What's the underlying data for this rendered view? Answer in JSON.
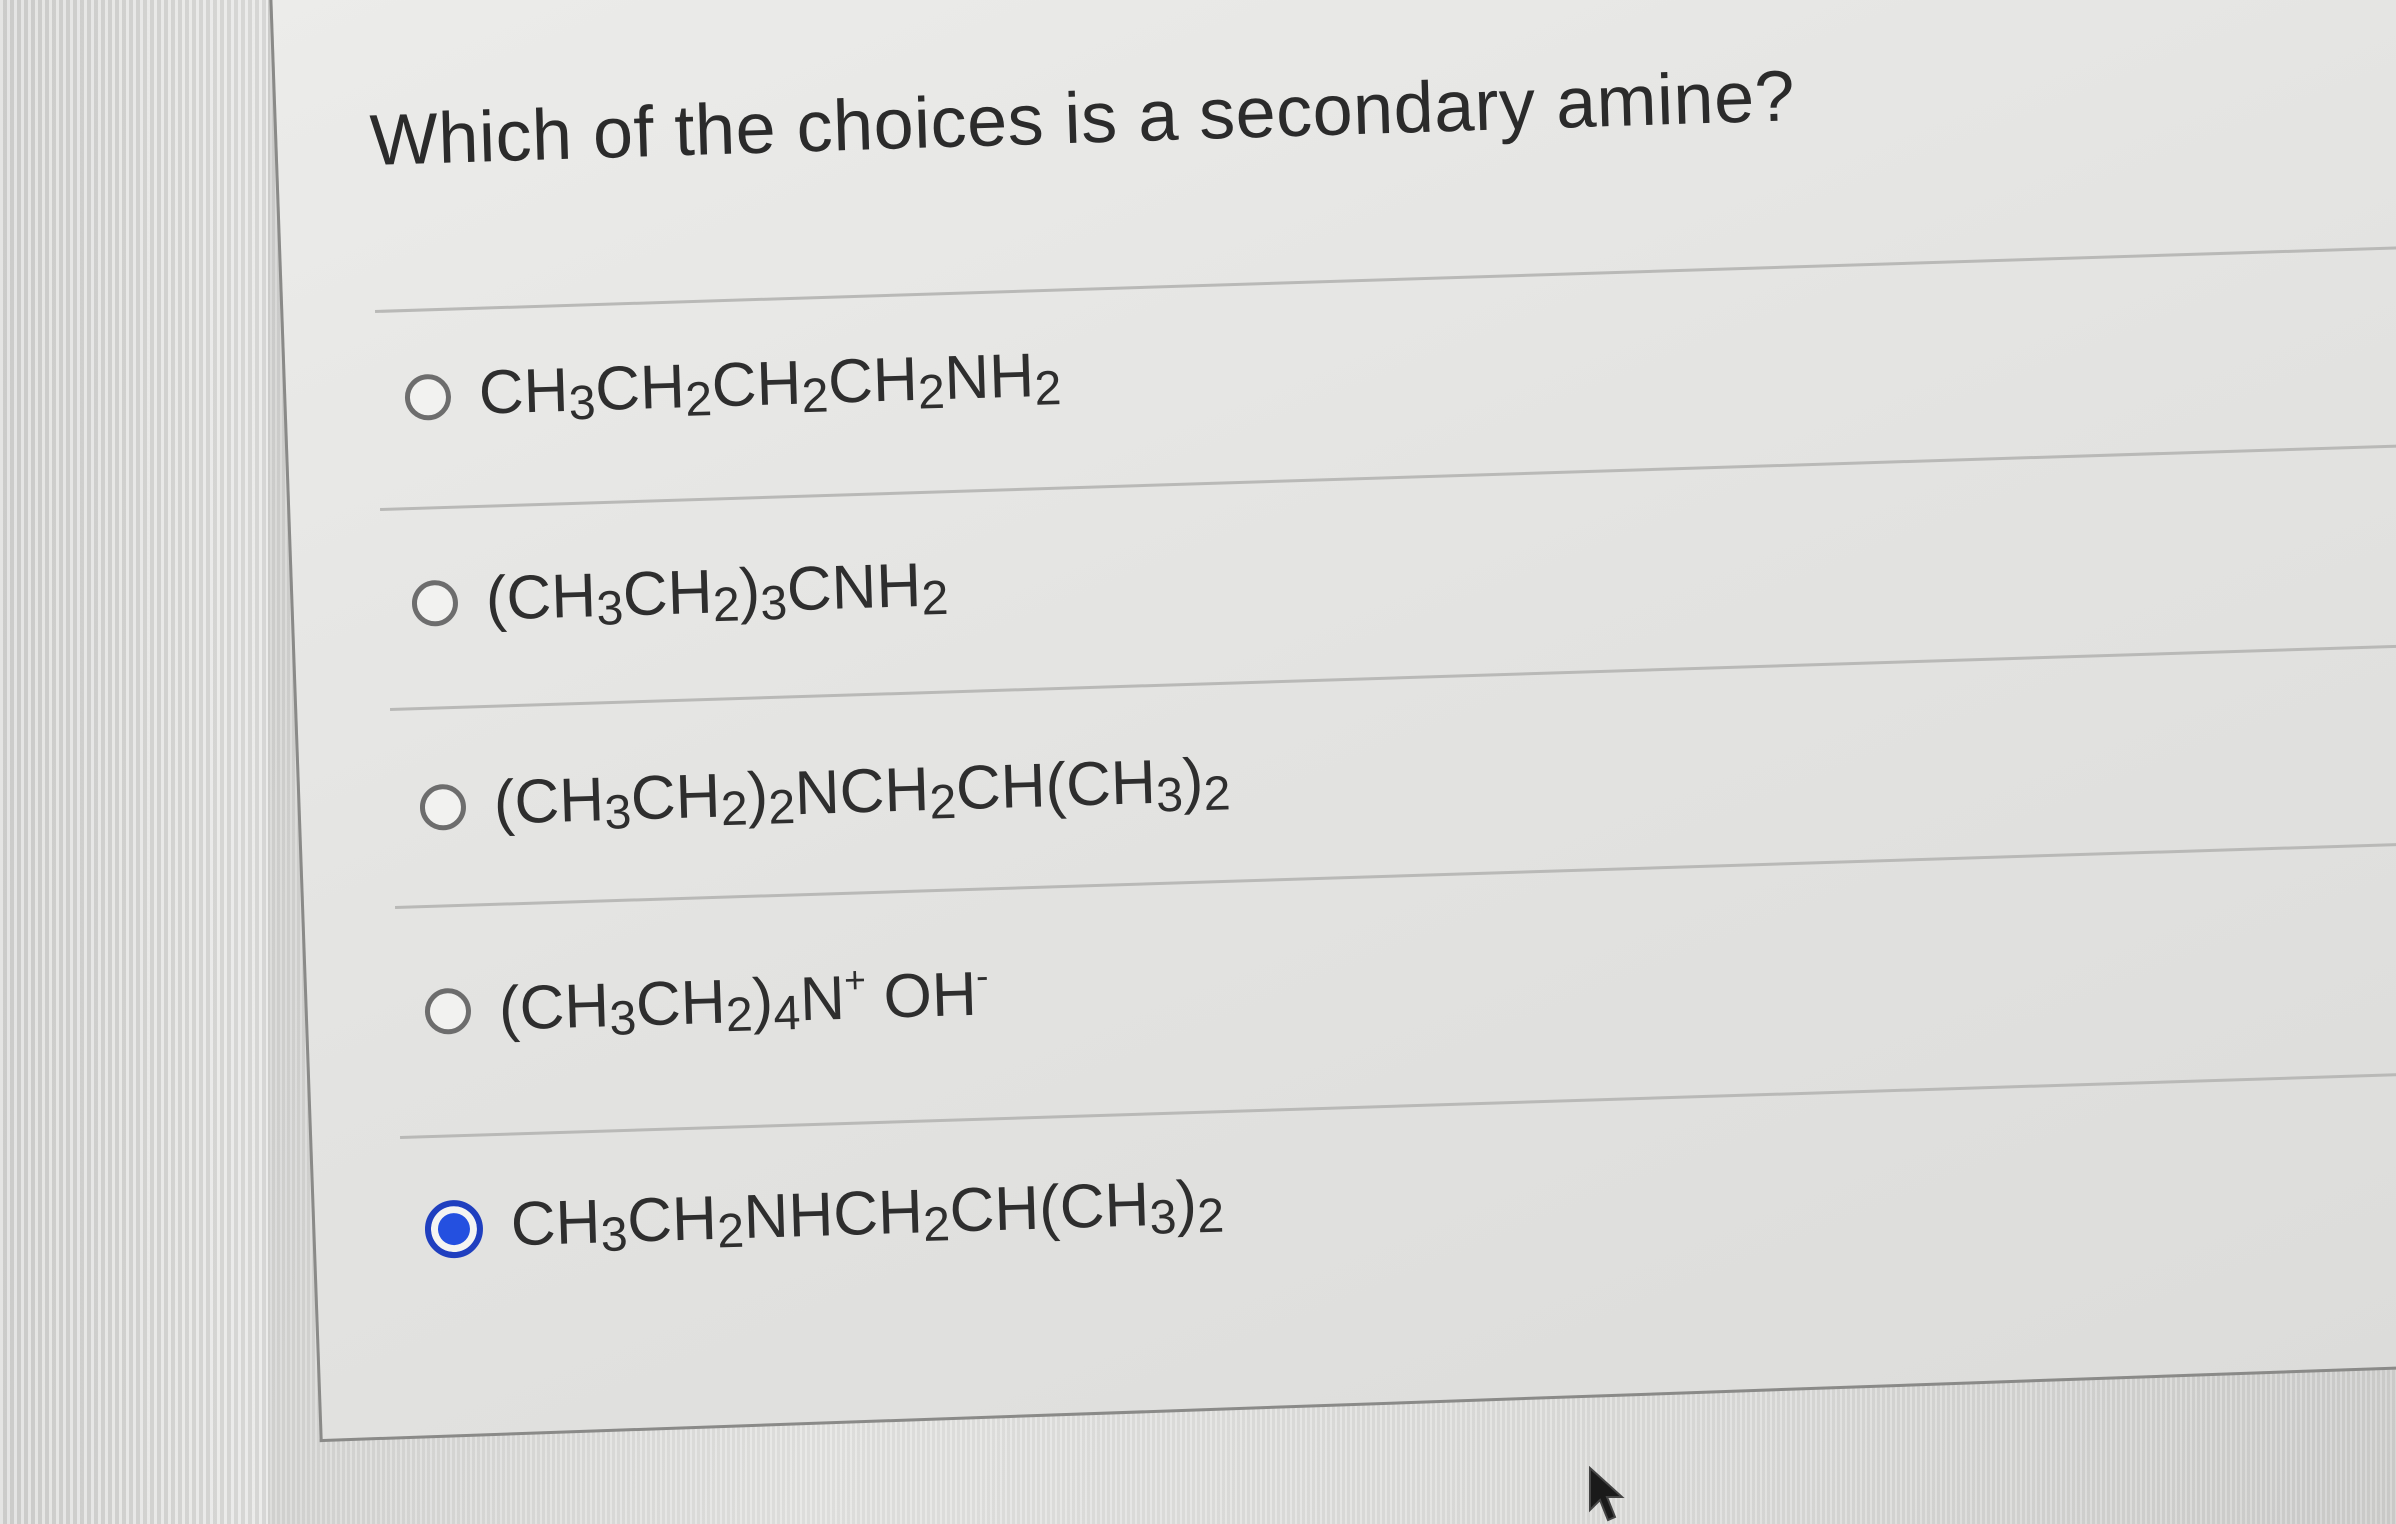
{
  "question": {
    "text": "Which of the choices is a secondary amine?"
  },
  "choices": [
    {
      "parts": [
        {
          "t": "CH"
        },
        {
          "sub": "3"
        },
        {
          "t": "CH"
        },
        {
          "sub": "2"
        },
        {
          "t": "CH"
        },
        {
          "sub": "2"
        },
        {
          "t": "CH"
        },
        {
          "sub": "2"
        },
        {
          "t": "NH"
        },
        {
          "sub": "2"
        }
      ],
      "selected": false
    },
    {
      "parts": [
        {
          "t": "(CH"
        },
        {
          "sub": "3"
        },
        {
          "t": "CH"
        },
        {
          "sub": "2"
        },
        {
          "t": ")"
        },
        {
          "sub": "3"
        },
        {
          "t": "CNH"
        },
        {
          "sub": "2"
        }
      ],
      "selected": false
    },
    {
      "parts": [
        {
          "t": "(CH"
        },
        {
          "sub": "3"
        },
        {
          "t": "CH"
        },
        {
          "sub": "2"
        },
        {
          "t": ")"
        },
        {
          "sub": "2"
        },
        {
          "t": "NCH"
        },
        {
          "sub": "2"
        },
        {
          "t": "CH(CH"
        },
        {
          "sub": "3"
        },
        {
          "t": ")"
        },
        {
          "sub": "2"
        }
      ],
      "selected": false
    },
    {
      "parts": [
        {
          "t": "(CH"
        },
        {
          "sub": "3"
        },
        {
          "t": "CH"
        },
        {
          "sub": "2"
        },
        {
          "t": ")"
        },
        {
          "sub": "4"
        },
        {
          "t": "N"
        },
        {
          "sup": "+"
        },
        {
          "t": " OH"
        },
        {
          "sup": "-"
        }
      ],
      "selected": false
    },
    {
      "parts": [
        {
          "t": "CH"
        },
        {
          "sub": "3"
        },
        {
          "t": "CH"
        },
        {
          "sub": "2"
        },
        {
          "t": "NHCH"
        },
        {
          "sub": "2"
        },
        {
          "t": "CH(CH"
        },
        {
          "sub": "3"
        },
        {
          "t": ")"
        },
        {
          "sub": "2"
        }
      ],
      "selected": true
    }
  ],
  "colors": {
    "selected_radio": "#2450e0",
    "text": "#2e2e2e"
  },
  "icons": {
    "cursor": "mouse-pointer-icon"
  }
}
